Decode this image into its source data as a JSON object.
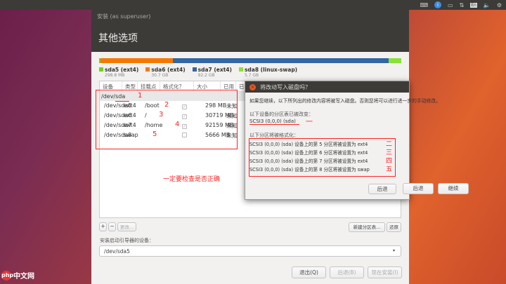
{
  "window": {
    "title": "安装 (as superuser)",
    "heading": "其他选项"
  },
  "partitions": [
    {
      "name": "sda5 (ext4)",
      "size": "298.8 MB",
      "color": "#73d216",
      "fraction": 0.002
    },
    {
      "name": "sda6 (ext4)",
      "size": "30.7 GB",
      "color": "#f57900",
      "fraction": 0.24
    },
    {
      "name": "sda7 (ext4)",
      "size": "92.2 GB",
      "color": "#3465a4",
      "fraction": 0.715
    },
    {
      "name": "sda8 (linux-swap)",
      "size": "5.7 GB",
      "color": "#8ae234",
      "fraction": 0.043
    }
  ],
  "table": {
    "headers": [
      "设备",
      "类型",
      "挂载点",
      "格式化？",
      "大小",
      "已用",
      "已"
    ],
    "disk": "/dev/sda",
    "rows": [
      {
        "device": "/dev/sda5",
        "type": "ext4",
        "mount": "/boot",
        "format": true,
        "size": "298 MB",
        "used": "未知",
        "mark": "2"
      },
      {
        "device": "/dev/sda6",
        "type": "ext4",
        "mount": "/",
        "format": true,
        "size": "30719 MB",
        "used": "未知",
        "mark": "3"
      },
      {
        "device": "/dev/sda7",
        "type": "ext4",
        "mount": "/home",
        "format": true,
        "size": "92159 MB",
        "used": "未知",
        "mark": "4"
      },
      {
        "device": "/dev/sda8",
        "type": "swap",
        "mount": "",
        "format": false,
        "size": "5666 MB",
        "used": "未知",
        "mark": "5"
      }
    ],
    "disk_mark": "1",
    "note": "一定要检查是否正确"
  },
  "controls": {
    "add": "+",
    "remove": "−",
    "change": "更改...",
    "new_table": "新建分区表...",
    "revert": "还原",
    "bootloader_label": "安装启动引导器的设备：",
    "bootloader_value": "/dev/sda5",
    "quit": "退出(Q)",
    "back": "后退(B)",
    "install": "现在安装(I)"
  },
  "dialog": {
    "title": "将改动写入磁盘吗？",
    "intro": "如果您继续，以下所列出的修改内容将被写入磁盘。否则您将可以进行进一步的手动修改。",
    "table_changed_label": "以下设备的分区表已被改变：",
    "device": "SCSI3 (0,0,0) (sda)",
    "device_mark": "一",
    "format_label": "以下分区将被格式化：",
    "items": [
      {
        "text": "SCSI3 (0,0,0) (sda) 设备上的第 5 分区将被设置为 ext4",
        "mark": "二"
      },
      {
        "text": "SCSI3 (0,0,0) (sda) 设备上的第 6 分区将被设置为 ext4",
        "mark": "三"
      },
      {
        "text": "SCSI3 (0,0,0) (sda) 设备上的第 7 分区将被设置为 ext4",
        "mark": "四"
      },
      {
        "text": "SCSI3 (0,0,0) (sda) 设备上的第 8 分区将被设置为 swap",
        "mark": "五"
      }
    ],
    "back": "后退",
    "continue": "继续"
  },
  "tray": {
    "lang": "En"
  },
  "watermark": "php 中文网"
}
